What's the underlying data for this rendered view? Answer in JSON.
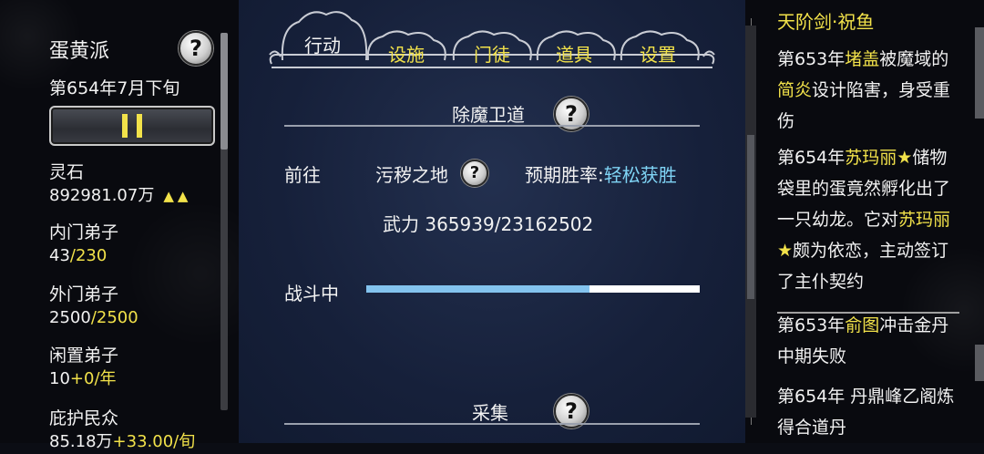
{
  "sidebar": {
    "sect_name": "蛋黄派",
    "date": "第654年7月下旬",
    "stats": [
      {
        "label": "灵石",
        "value": "892981.07万",
        "trend": "▲▲"
      },
      {
        "label": "内门弟子",
        "value": "43",
        "max": "/230"
      },
      {
        "label": "外门弟子",
        "value": "2500",
        "max": "/2500"
      },
      {
        "label": "闲置弟子",
        "value": "10",
        "rate": "+0/年"
      },
      {
        "label": "庇护民众",
        "value": "85.18万",
        "rate": "+33.00/旬"
      }
    ]
  },
  "tabs": [
    "行动",
    "设施",
    "门徒",
    "道具",
    "设置"
  ],
  "main": {
    "section1_title": "除魔卫道",
    "goto_label": "前往",
    "location": "污秽之地",
    "win_rate_label": "预期胜率:",
    "win_rate_value": "轻松获胜",
    "power_line": "武力 365939/23162502",
    "battle_label": "战斗中",
    "battle_progress_pct": 67,
    "section2_title": "采集"
  },
  "log": {
    "title": "天阶剑·祝鱼",
    "entry1": {
      "pre": "第653年",
      "name1": "堵盖",
      "mid1": "被魔域的",
      "name2": "简炎",
      "post": "设计陷害，身受重伤"
    },
    "entry2": {
      "pre": "第654年",
      "name1": "苏玛丽★",
      "mid1": "储物袋里的蛋竟然孵化出了一只幼龙。它对",
      "name2": "苏玛丽★",
      "post": "颇为依恋，主动签订了主仆契约"
    },
    "entry3": {
      "pre": "第653年",
      "name1": "俞图",
      "post": "冲击金丹中期失败"
    },
    "entry4": {
      "text": "第654年 丹鼎峰乙阁炼得合道丹"
    }
  },
  "colors": {
    "accent": "#f2e24a",
    "cyan": "#7fd4f5",
    "progress": "#83c3ee"
  },
  "icons": {
    "help": "?"
  }
}
